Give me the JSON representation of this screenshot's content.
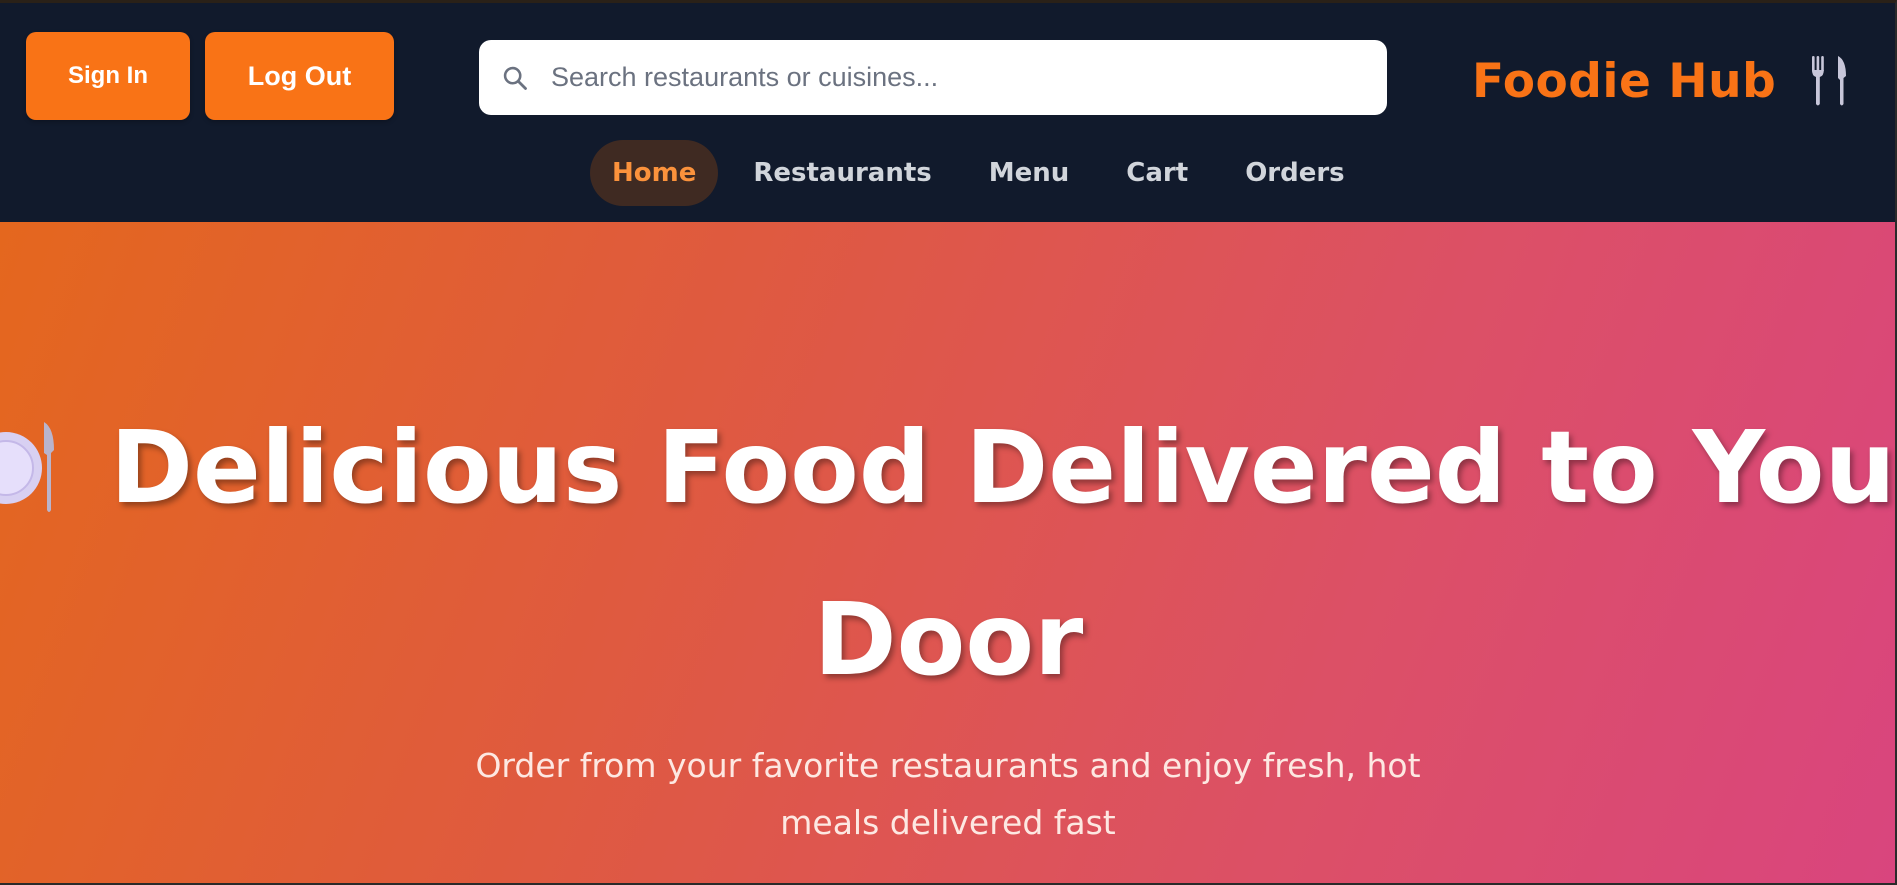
{
  "header": {
    "sign_in_label": "Sign In",
    "log_out_label": "Log Out",
    "search": {
      "placeholder": "Search restaurants or cuisines...",
      "icon": "search-icon"
    },
    "brand": {
      "name": "Foodie Hub",
      "icon": "fork-knife-icon",
      "color": "#f97316"
    },
    "nav": [
      {
        "label": "Home",
        "active": true
      },
      {
        "label": "Restaurants",
        "active": false
      },
      {
        "label": "Menu",
        "active": false
      },
      {
        "label": "Cart",
        "active": false
      },
      {
        "label": "Orders",
        "active": false
      }
    ]
  },
  "hero": {
    "icon": "plate-with-cutlery-icon",
    "title_line1": "Delicious Food Delivered to Your",
    "title_line2": "Door",
    "subtitle": "Order from your favorite restaurants and enjoy fresh, hot meals delivered fast"
  },
  "colors": {
    "header_bg": "#111a2c",
    "accent": "#f97316",
    "hero_gradient_start": "#e4671e",
    "hero_gradient_end": "#d9457e"
  }
}
